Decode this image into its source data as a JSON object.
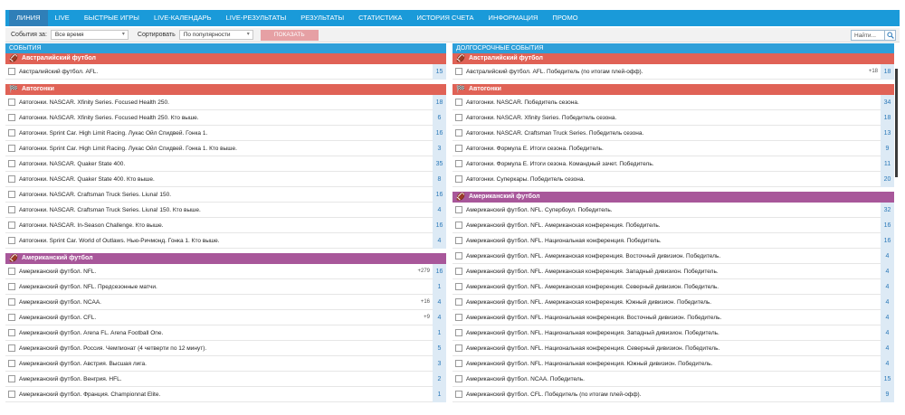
{
  "nav": {
    "items": [
      {
        "label": "ЛИНИЯ",
        "active": true
      },
      {
        "label": "LIVE"
      },
      {
        "label": "БЫСТРЫЕ ИГРЫ"
      },
      {
        "label": "LIVE-КАЛЕНДАРЬ"
      },
      {
        "label": "LIVE-РЕЗУЛЬТАТЫ"
      },
      {
        "label": "РЕЗУЛЬТАТЫ"
      },
      {
        "label": "СТАТИСТИКА"
      },
      {
        "label": "ИСТОРИЯ СЧЕТА"
      },
      {
        "label": "ИНФОРМАЦИЯ"
      },
      {
        "label": "ПРОМО"
      }
    ]
  },
  "filters": {
    "events_for_label": "События за:",
    "events_for_value": "Все время",
    "sort_label": "Сортировать",
    "sort_value": "По популярности",
    "show_button": "ПОКАЗАТЬ",
    "search_placeholder": "Найти..."
  },
  "left": {
    "header": "СОБЫТИЯ",
    "groups": [
      {
        "sport": "Австралийский футбол",
        "kind": "aussie",
        "icon": "football-icon",
        "rows": [
          {
            "name": "Австралийский футбол. AFL.",
            "count": "15"
          }
        ]
      },
      {
        "sport": "Автогонки",
        "kind": "auto",
        "icon": "flag-icon",
        "rows": [
          {
            "name": "Автогонки. NASCAR. Xfinity Series. Focused Health 250.",
            "count": "18"
          },
          {
            "name": "Автогонки. NASCAR. Xfinity Series. Focused Health 250. Кто выше.",
            "count": "6"
          },
          {
            "name": "Автогонки. Sprint Car. High Limit Racing. Лукас Ойл Спидвей. Гонка 1.",
            "count": "16"
          },
          {
            "name": "Автогонки. Sprint Car. High Limit Racing. Лукас Ойл Спидвей. Гонка 1. Кто выше.",
            "count": "3"
          },
          {
            "name": "Автогонки. NASCAR. Quaker State 400.",
            "count": "35"
          },
          {
            "name": "Автогонки. NASCAR. Quaker State 400. Кто выше.",
            "count": "8"
          },
          {
            "name": "Автогонки. NASCAR. Craftsman Truck Series. Liuna! 150.",
            "count": "16"
          },
          {
            "name": "Автогонки. NASCAR. Craftsman Truck Series. Liuna! 150. Кто выше.",
            "count": "4"
          },
          {
            "name": "Автогонки. NASCAR. In-Season Challenge. Кто выше.",
            "count": "16"
          },
          {
            "name": "Автогонки. Sprint Car. World of Outlaws. Нью-Ричмонд. Гонка 1. Кто выше.",
            "count": "4"
          }
        ]
      },
      {
        "sport": "Американский футбол",
        "kind": "american",
        "icon": "football-icon",
        "rows": [
          {
            "name": "Американский футбол. NFL.",
            "plus": "+279",
            "count": "16"
          },
          {
            "name": "Американский футбол. NFL. Предсезонные матчи.",
            "count": "1"
          },
          {
            "name": "Американский футбол. NCAA.",
            "plus": "+16",
            "count": "4"
          },
          {
            "name": "Американский футбол. CFL.",
            "plus": "+9",
            "count": "4"
          },
          {
            "name": "Американский футбол. Arena FL. Arena Football One.",
            "count": "1"
          },
          {
            "name": "Американский футбол. Россия. Чемпионат (4 четверти по 12 минут).",
            "count": "5"
          },
          {
            "name": "Американский футбол. Австрия. Высшая лига.",
            "count": "3"
          },
          {
            "name": "Американский футбол. Венгрия. HFL.",
            "count": "2"
          },
          {
            "name": "Американский футбол. Франция. Championnat Elite.",
            "count": "1"
          }
        ]
      }
    ]
  },
  "right": {
    "header": "ДОЛГОСРОЧНЫЕ СОБЫТИЯ",
    "groups": [
      {
        "sport": "Австралийский футбол",
        "kind": "aussie",
        "icon": "football-icon",
        "rows": [
          {
            "name": "Австралийский футбол. AFL. Победитель (по итогам плей-офф).",
            "plus": "+18",
            "count": "18"
          }
        ]
      },
      {
        "sport": "Автогонки",
        "kind": "auto",
        "icon": "flag-icon",
        "rows": [
          {
            "name": "Автогонки. NASCAR. Победитель сезона.",
            "count": "34"
          },
          {
            "name": "Автогонки. NASCAR. Xfinity Series. Победитель сезона.",
            "count": "18"
          },
          {
            "name": "Автогонки. NASCAR. Craftsman Truck Series. Победитель сезона.",
            "count": "13"
          },
          {
            "name": "Автогонки. Формула Е. Итоги сезона. Победитель.",
            "count": "9"
          },
          {
            "name": "Автогонки. Формула Е. Итоги сезона. Командный зачет. Победитель.",
            "count": "11"
          },
          {
            "name": "Автогонки. Суперкары. Победитель сезона.",
            "count": "20"
          }
        ]
      },
      {
        "sport": "Американский футбол",
        "kind": "american",
        "icon": "football-icon",
        "rows": [
          {
            "name": "Американский футбол. NFL. Супербоул. Победитель.",
            "count": "32"
          },
          {
            "name": "Американский футбол. NFL. Американская конференция. Победитель.",
            "count": "16"
          },
          {
            "name": "Американский футбол. NFL. Национальная конференция. Победитель.",
            "count": "16"
          },
          {
            "name": "Американский футбол. NFL. Американская конференция. Восточный дивизион. Победитель.",
            "count": "4"
          },
          {
            "name": "Американский футбол. NFL. Американская конференция. Западный дивизион. Победитель.",
            "count": "4"
          },
          {
            "name": "Американский футбол. NFL. Американская конференция. Северный дивизион. Победитель.",
            "count": "4"
          },
          {
            "name": "Американский футбол. NFL. Американская конференция. Южный дивизион. Победитель.",
            "count": "4"
          },
          {
            "name": "Американский футбол. NFL. Национальная конференция. Восточный дивизион. Победитель.",
            "count": "4"
          },
          {
            "name": "Американский футбол. NFL. Национальная конференция. Западный дивизион. Победитель.",
            "count": "4"
          },
          {
            "name": "Американский футбол. NFL. Национальная конференция. Северный дивизион. Победитель.",
            "count": "4"
          },
          {
            "name": "Американский футбол. NFL. Национальная конференция. Южный дивизион. Победитель.",
            "count": "4"
          },
          {
            "name": "Американский футбол. NCAA. Победитель.",
            "count": "15"
          },
          {
            "name": "Американский футбол. CFL. Победитель (по итогам плей-офф).",
            "count": "9"
          }
        ]
      }
    ]
  }
}
